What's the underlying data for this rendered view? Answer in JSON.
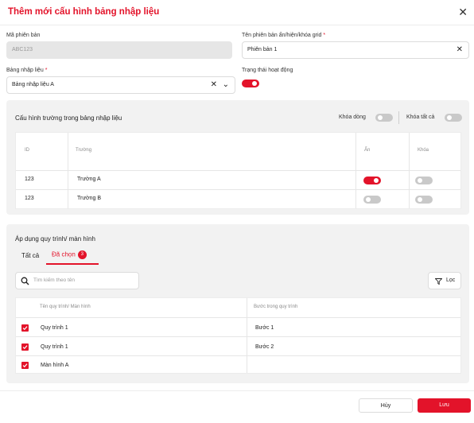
{
  "dialog": {
    "title": "Thêm mới cấu hình bảng nhập liệu"
  },
  "form": {
    "version_code_label": "Mã phiên bản",
    "version_code_value": "ABC123",
    "version_name_label": "Tên phiên bản ẩn/hiện/khóa grid",
    "version_name_value": "Phiên bản 1",
    "table_label": "Bảng nhập liệu",
    "table_value": "Bảng nhập liệu A",
    "status_label": "Trạng thái hoạt động",
    "status_on": true,
    "required_mark": "*"
  },
  "field_config": {
    "title": "Cấu hình trường trong bảng nhập liệu",
    "lock_row_label": "Khóa dòng",
    "lock_all_label": "Khóa tất cả",
    "columns": [
      "ID",
      "Trường",
      "Ẩn",
      "Khóa"
    ],
    "rows": [
      {
        "id": "123",
        "field": "Trường A",
        "hidden": true,
        "locked": false
      },
      {
        "id": "123",
        "field": "Trường B",
        "hidden": false,
        "locked": false
      }
    ]
  },
  "apply": {
    "title": "Áp dụng quy trình/ màn hình",
    "tabs": {
      "all": "Tất cả",
      "selected": "Đã chọn",
      "selected_count": "3"
    },
    "search_placeholder": "Tìm kiếm theo tên",
    "filter_label": "Lọc",
    "columns": [
      "Tên quy trình/ Màn hình",
      "Bước trong quy trình"
    ],
    "rows": [
      {
        "name": "Quy trình 1",
        "step": "Bước 1",
        "checked": true
      },
      {
        "name": "Quy trình 1",
        "step": "Bước 2",
        "checked": true
      },
      {
        "name": "Màn hình A",
        "step": "",
        "checked": true
      }
    ]
  },
  "footer": {
    "cancel_label": "Hủy",
    "save_label": "Lưu"
  },
  "colors": {
    "accent": "#e3132a",
    "panel_bg": "#f2f2f2"
  },
  "icons": [
    "close-icon",
    "clear-icon",
    "chevron-down-icon",
    "search-icon",
    "filter-icon",
    "check-icon"
  ]
}
